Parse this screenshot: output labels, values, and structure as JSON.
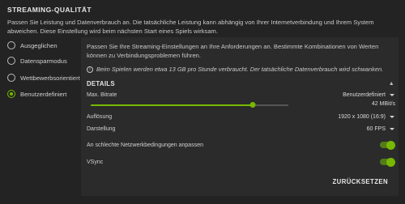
{
  "header": {
    "title": "STREAMING-QUALITÄT",
    "description": "Passen Sie Leistung und Datenverbrauch an. Die tatsächliche Leistung kann abhängig von Ihrer Internetverbindung und Ihrem System abweichen. Diese Einstellung wird beim nächsten Start eines Spiels wirksam."
  },
  "options": [
    {
      "label": "Ausgeglichen",
      "selected": false
    },
    {
      "label": "Datensparmodus",
      "selected": false
    },
    {
      "label": "Wettbewerbsorientiert",
      "selected": false
    },
    {
      "label": "Benutzerdefiniert",
      "selected": true
    }
  ],
  "panel": {
    "description": "Passen Sie Ihre Streaming-Einstellungen an Ihre Anforderungen an. Bestimmte Kombinationen von Werten können zu Verbindungsproblemen führen.",
    "info": "Beim Spielen werden etwa 13 GB pro Stunde verbraucht. Der tatsächliche Datenverbrauch wird schwanken.",
    "details_title": "DETAILS",
    "max_bitrate": {
      "label": "Max. Bitrate",
      "dropdown_value": "Benutzerdefiniert",
      "value_text": "42 MBit/s",
      "slider_fraction": 0.82
    },
    "resolution": {
      "label": "Auflösung",
      "value": "1920 x 1080 (16:9)"
    },
    "framerate": {
      "label": "Darstellung",
      "value": "60 FPS"
    },
    "adapt_network": {
      "label": "An schlechte Netzwerkbedingungen anpassen",
      "enabled": true
    },
    "vsync": {
      "label": "VSync",
      "enabled": true
    },
    "reset_label": "ZURÜCKSETZEN"
  },
  "colors": {
    "accent": "#76b900",
    "background": "#232323",
    "panel": "#2b2b2b"
  }
}
